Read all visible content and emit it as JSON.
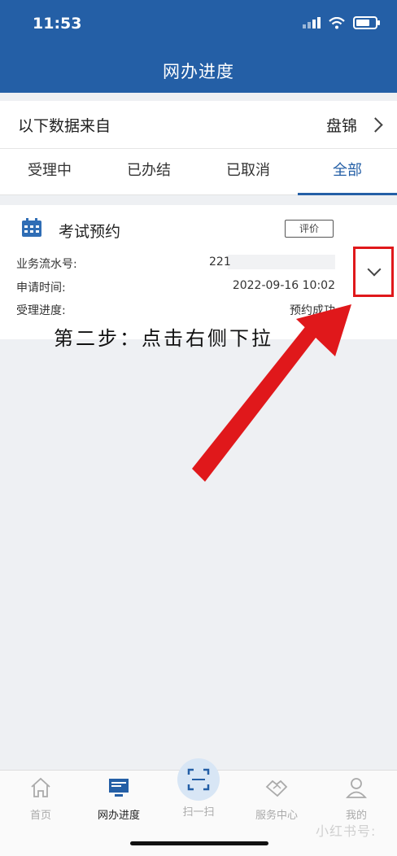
{
  "status_bar": {
    "time": "11:53"
  },
  "header": {
    "title": "网办进度"
  },
  "source": {
    "label": "以下数据来自",
    "city": "盘锦"
  },
  "tabs": [
    {
      "label": "受理中"
    },
    {
      "label": "已办结"
    },
    {
      "label": "已取消"
    },
    {
      "label": "全部",
      "active": true
    }
  ],
  "card": {
    "title": "考试预约",
    "rate_label": "评价",
    "rows": [
      {
        "key": "业务流水号:",
        "value": "221"
      },
      {
        "key": "申请时间:",
        "value": "2022-09-16 10:02"
      },
      {
        "key": "受理进度:",
        "value": "预约成功"
      }
    ]
  },
  "annotation": {
    "text": "第二步：点击右侧下拉",
    "color": "#e0181b"
  },
  "colors": {
    "brand": "#245fa6",
    "highlight": "#e0181b"
  },
  "bottom_nav": [
    {
      "label": "首页",
      "icon": "home-icon"
    },
    {
      "label": "网办进度",
      "icon": "monitor-icon",
      "active": true
    },
    {
      "label": "扫一扫",
      "icon": "scan-icon"
    },
    {
      "label": "服务中心",
      "icon": "handshake-icon"
    },
    {
      "label": "我的",
      "icon": "user-icon"
    }
  ],
  "watermark": "小红书号:"
}
